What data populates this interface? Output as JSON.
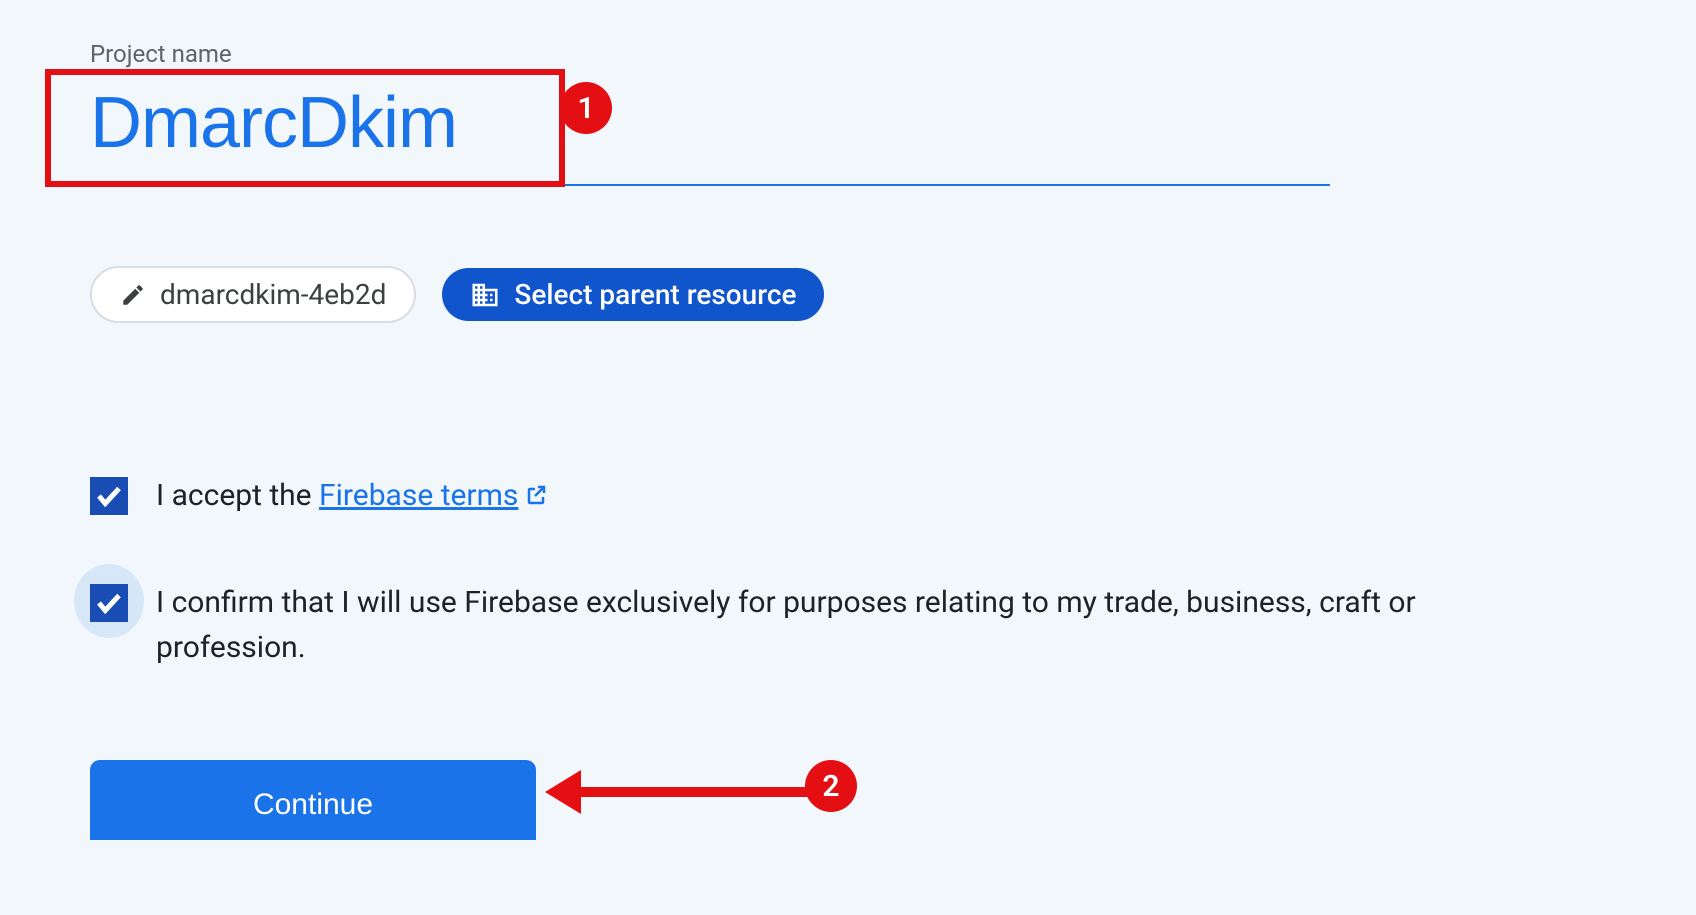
{
  "field": {
    "label": "Project name",
    "value": "DmarcDkim"
  },
  "chips": {
    "projectId": "dmarcdkim-4eb2d",
    "selectParent": "Select parent resource"
  },
  "checkboxes": {
    "terms": {
      "prefix": "I accept the ",
      "linkText": "Firebase terms",
      "checked": true
    },
    "confirm": {
      "text": "I confirm that I will use Firebase exclusively for purposes relating to my trade, business, craft or profession.",
      "checked": true
    }
  },
  "continueLabel": "Continue",
  "callouts": {
    "one": "1",
    "two": "2"
  }
}
